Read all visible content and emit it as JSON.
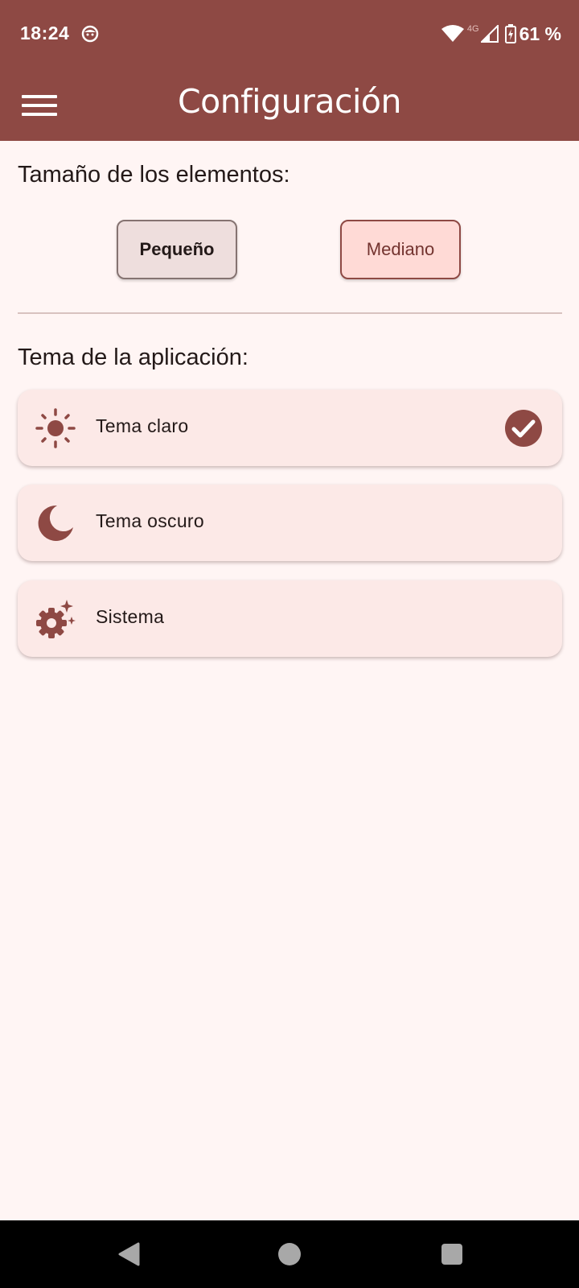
{
  "status_bar": {
    "time": "18:24",
    "network_type": "4G",
    "battery_percent": "61 %"
  },
  "app_bar": {
    "title": "Configuración",
    "menu_icon": "hamburger-menu-icon"
  },
  "size_section": {
    "title": "Tamaño de los elementos:",
    "options": [
      {
        "label": "Pequeño"
      },
      {
        "label": "Mediano"
      }
    ]
  },
  "theme_section": {
    "title": "Tema de la aplicación:",
    "options": [
      {
        "label": "Tema claro",
        "icon": "sun-icon",
        "selected": true
      },
      {
        "label": "Tema oscuro",
        "icon": "moon-icon",
        "selected": false
      },
      {
        "label": "Sistema",
        "icon": "settings-auto-icon",
        "selected": false
      }
    ]
  },
  "colors": {
    "primary": "#8E4944",
    "background": "#FFF5F4",
    "card": "#FCE9E7",
    "selected_button": "#FFDAD6"
  },
  "nav_bar": {
    "icons": [
      "back-icon",
      "home-icon",
      "recents-icon"
    ]
  }
}
